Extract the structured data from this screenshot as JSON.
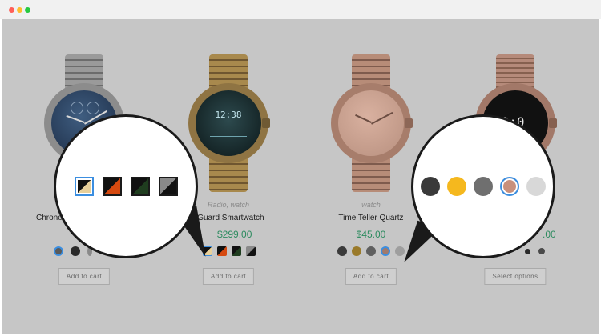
{
  "window": {
    "dots": [
      {
        "name": "close",
        "color": "#ff5f57"
      },
      {
        "name": "minimize",
        "color": "#ffbd2e"
      },
      {
        "name": "maximize",
        "color": "#28c940"
      }
    ]
  },
  "products": [
    {
      "name": "Chrono",
      "add_label": "Add to cart",
      "swatches": [
        {
          "name": "steel-dial-swatch",
          "selected": true
        },
        {
          "name": "black-dial-swatch",
          "selected": false
        },
        {
          "name": "small-dial-swatch",
          "selected": false
        }
      ]
    },
    {
      "category": "Radio, watch",
      "name": "ll Guard Smartwatch",
      "price": "$299.00",
      "add_label": "Add to cart",
      "swatches": [
        {
          "name": "gold-swatch",
          "colors": [
            "#e8d09a",
            "#111111"
          ],
          "selected": true
        },
        {
          "name": "orange-swatch",
          "colors": [
            "#d64a10",
            "#111111"
          ],
          "selected": false
        },
        {
          "name": "green-swatch",
          "colors": [
            "#1f3d1f",
            "#111111"
          ],
          "selected": false
        },
        {
          "name": "grey-swatch",
          "colors": [
            "#8a8a8a",
            "#111111"
          ],
          "selected": false
        }
      ]
    },
    {
      "category": "watch",
      "name": "Time Teller Quartz",
      "price": "$45.00",
      "add_label": "Add to cart",
      "swatches": [
        {
          "name": "black-swatch",
          "color": "#3a3a3a",
          "selected": false
        },
        {
          "name": "yellow-swatch",
          "color": "#f5b81e",
          "selected": false
        },
        {
          "name": "grey-swatch",
          "color": "#6f6f6f",
          "selected": false
        },
        {
          "name": "rose-swatch",
          "color": "#c8907c",
          "selected": true
        },
        {
          "name": "silver-swatch",
          "color": "#d8d8d8",
          "selected": false
        }
      ]
    },
    {
      "price": ".00",
      "add_label": "Select options",
      "swatches": [
        {
          "name": "dark-swatch",
          "selected": false
        },
        {
          "name": "steel-swatch",
          "selected": false
        }
      ]
    }
  ],
  "colors": {
    "overlay": "#c6c6c6",
    "price": "#2c8b5f",
    "selected_ring": "#3b8ee0"
  }
}
